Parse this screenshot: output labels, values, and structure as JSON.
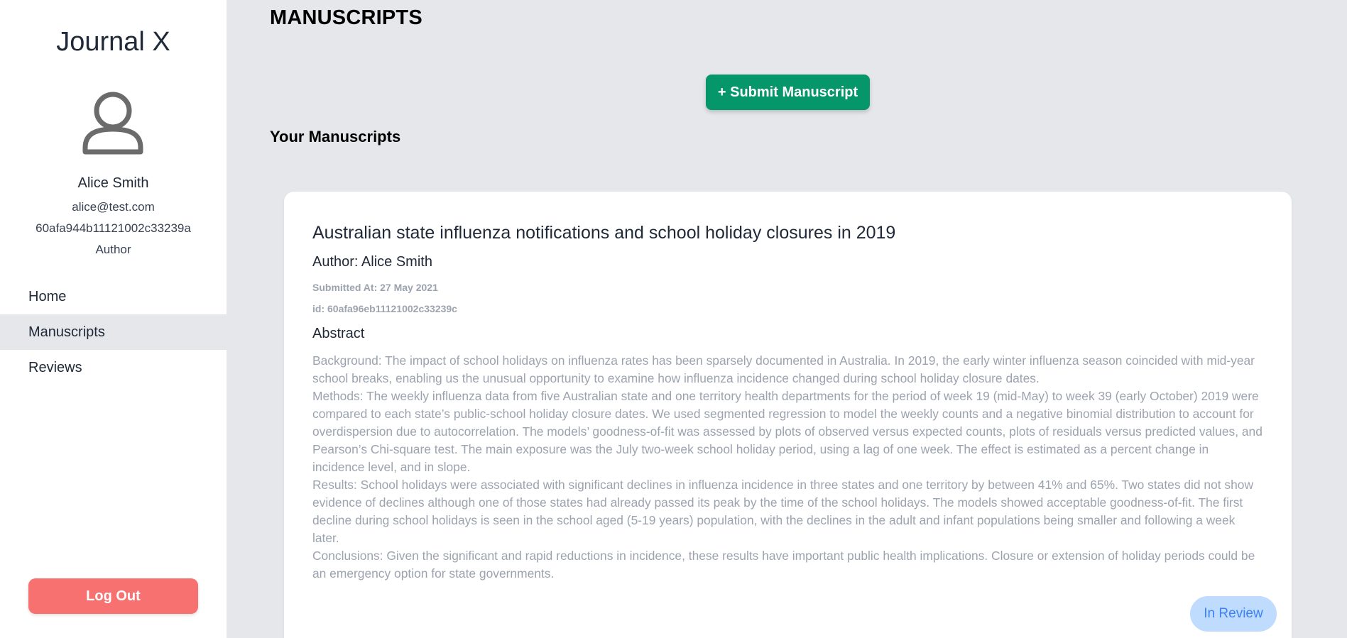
{
  "sidebar": {
    "brand": "Journal X",
    "user": {
      "name": "Alice Smith",
      "email": "alice@test.com",
      "id": "60afa944b11121002c33239a",
      "role": "Author"
    },
    "nav": [
      {
        "label": "Home",
        "active": false
      },
      {
        "label": "Manuscripts",
        "active": true
      },
      {
        "label": "Reviews",
        "active": false
      }
    ],
    "logout_label": "Log Out"
  },
  "main": {
    "title": "MANUSCRIPTS",
    "submit_label": "+ Submit Manuscript",
    "section_title": "Your Manuscripts",
    "manuscripts": [
      {
        "title": "Australian state influenza notifications and school holiday closures in 2019",
        "author": "Author: Alice Smith",
        "submitted": "Submitted At: 27 May 2021",
        "id": "id: 60afa96eb11121002c33239c",
        "abstract_label": "Abstract",
        "abstract": [
          "Background: The impact of school holidays on influenza rates has been sparsely documented in Australia. In 2019, the early winter influenza season coincided with mid-year school breaks, enabling us the unusual opportunity to examine how influenza incidence changed during school holiday closure dates.",
          "Methods: The weekly influenza data from five Australian state and one territory health departments for the period of week 19 (mid-May) to week 39 (early October) 2019 were compared to each state’s public-school holiday closure dates. We used segmented regression to model the weekly counts and a negative binomial distribution to account for overdispersion due to autocorrelation. The models’ goodness-of-fit was assessed by plots of observed versus expected counts, plots of residuals versus predicted values, and Pearson’s Chi-square test. The main exposure was the July two-week school holiday period, using a lag of one week. The effect is estimated as a percent change in incidence level, and in slope.",
          "Results: School holidays were associated with significant declines in influenza incidence in three states and one territory by between 41% and 65%. Two states did not show evidence of declines although one of those states had already passed its peak by the time of the school holidays. The models showed acceptable goodness-of-fit. The first decline during school holidays is seen in the school aged (5-19 years) population, with the declines in the adult and infant populations being smaller and following a week later.",
          "Conclusions: Given the significant and rapid reductions in incidence, these results have important public health implications. Closure or extension of holiday periods could be an emergency option for state governments."
        ],
        "status": "In Review"
      }
    ]
  },
  "icons": {
    "avatar": "user-outline-icon"
  },
  "colors": {
    "sidebar_bg": "#ffffff",
    "main_bg": "#e5e7eb",
    "submit_green": "#059669",
    "logout_red": "#f87171",
    "status_badge_bg": "#bfdbfe",
    "status_badge_text": "#3b82f6"
  }
}
